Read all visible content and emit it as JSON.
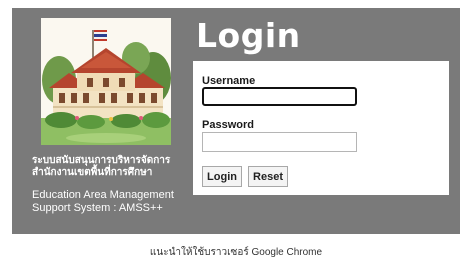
{
  "header": {
    "title": "Login"
  },
  "sidebar": {
    "system_name_th": "ระบบสนับสนุนการบริหารจัดการ สำนักงานเขตพื้นที่การศึกษา",
    "system_name_en": "Education Area Management Support System : AMSS++",
    "image_icon": "school-building-illustration"
  },
  "form": {
    "username_label": "Username",
    "username_value": "",
    "password_label": "Password",
    "password_value": "",
    "login_button": "Login",
    "reset_button": "Reset"
  },
  "footer": {
    "note": "แนะนำให้ใช้บราวเซอร์ Google Chrome"
  },
  "colors": {
    "panel": "#7a7a7a",
    "form_bg": "#ffffff",
    "text_light": "#ffffff"
  }
}
